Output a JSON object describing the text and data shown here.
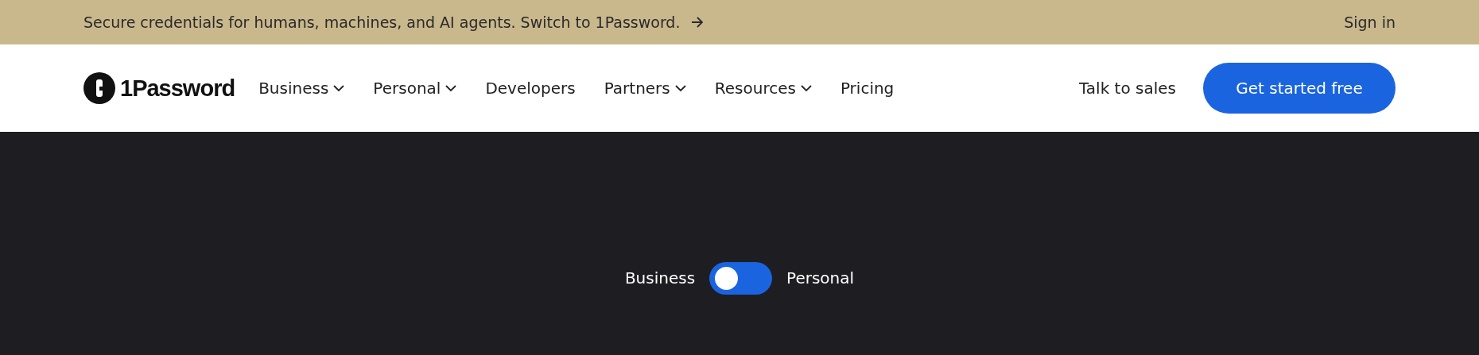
{
  "banner": {
    "message": "Secure credentials for humans, machines, and AI agents. Switch to 1Password.",
    "sign_in": "Sign in"
  },
  "nav": {
    "logo": "1Password",
    "links": [
      {
        "label": "Business",
        "dropdown": true
      },
      {
        "label": "Personal",
        "dropdown": true
      },
      {
        "label": "Developers",
        "dropdown": false
      },
      {
        "label": "Partners",
        "dropdown": true
      },
      {
        "label": "Resources",
        "dropdown": true
      },
      {
        "label": "Pricing",
        "dropdown": false
      }
    ],
    "talk_to_sales": "Talk to sales",
    "cta": "Get started free"
  },
  "plan_toggle": {
    "left_label": "Business",
    "right_label": "Personal",
    "on": false
  }
}
